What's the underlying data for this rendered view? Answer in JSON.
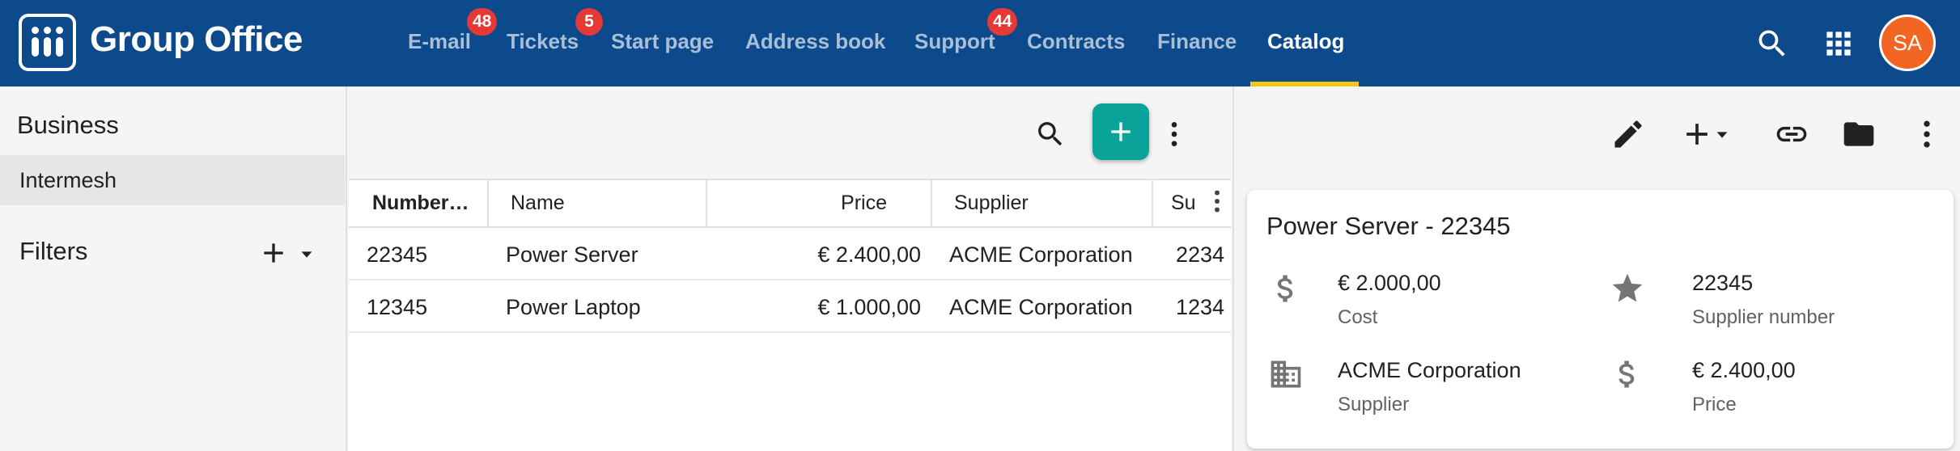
{
  "app": {
    "title": "Group Office",
    "avatar_initials": "SA"
  },
  "nav": {
    "items": [
      {
        "label": "E-mail",
        "badge": "48"
      },
      {
        "label": "Tickets",
        "badge": "5"
      },
      {
        "label": "Start page",
        "badge": ""
      },
      {
        "label": "Address book",
        "badge": ""
      },
      {
        "label": "Support",
        "badge": "44"
      },
      {
        "label": "Contracts",
        "badge": ""
      },
      {
        "label": "Finance",
        "badge": ""
      },
      {
        "label": "Catalog",
        "badge": ""
      }
    ],
    "active": "Catalog"
  },
  "sidebar": {
    "heading": "Business",
    "items": [
      {
        "label": "Intermesh"
      }
    ],
    "filters_label": "Filters"
  },
  "grid": {
    "columns": [
      "Number…",
      "Name",
      "Price",
      "Supplier",
      "Su"
    ],
    "rows": [
      {
        "number": "22345",
        "name": "Power Server",
        "price": "€ 2.400,00",
        "supplier": "ACME Corporation",
        "supplier_number": "2234"
      },
      {
        "number": "12345",
        "name": "Power Laptop",
        "price": "€ 1.000,00",
        "supplier": "ACME Corporation",
        "supplier_number": "1234"
      }
    ]
  },
  "detail": {
    "title": "Power Server - 22345",
    "fields": {
      "cost": {
        "value": "€ 2.000,00",
        "label": "Cost"
      },
      "supplier_number": {
        "value": "22345",
        "label": "Supplier number"
      },
      "supplier": {
        "value": "ACME Corporation",
        "label": "Supplier"
      },
      "price": {
        "value": "€ 2.400,00",
        "label": "Price"
      }
    }
  },
  "colors": {
    "topbar": "#0c4a8c",
    "nav_inactive": "#a9bfd8",
    "active_underline": "#f5c518",
    "badge": "#e53935",
    "fab": "#0aa39a",
    "avatar": "#f26522"
  },
  "icons": [
    "apps-logo-icon",
    "search-icon",
    "apps-grid-icon",
    "add-icon",
    "caret-down-icon",
    "more-vert-icon",
    "edit-icon",
    "link-icon",
    "folder-icon",
    "dollar-icon",
    "star-icon",
    "building-icon"
  ]
}
